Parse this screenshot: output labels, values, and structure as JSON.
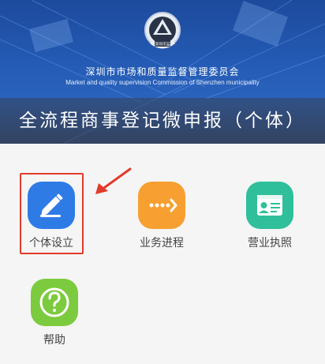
{
  "banner": {
    "emblem_text": "深圳市监",
    "org_name_cn": "深圳市市场和质量监督管理委员会",
    "org_name_en": "Market and quality supervision Commission of Shenzhen municipality",
    "title": "全流程商事登记微申报（个体）"
  },
  "menu": {
    "items": [
      {
        "label": "个体设立",
        "icon": "pencil-icon",
        "color": "#2f7be6"
      },
      {
        "label": "业务进程",
        "icon": "dots-arrow-icon",
        "color": "#f7a031"
      },
      {
        "label": "营业执照",
        "icon": "license-card-icon",
        "color": "#2fbf9a"
      },
      {
        "label": "帮助",
        "icon": "question-icon",
        "color": "#7ccb3f"
      }
    ]
  },
  "annotation": {
    "highlight_color": "#e23b2b"
  }
}
